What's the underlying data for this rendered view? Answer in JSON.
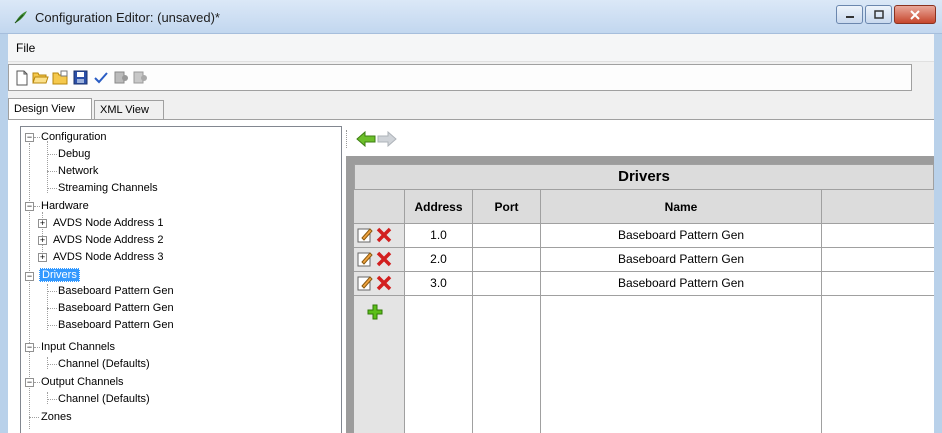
{
  "window": {
    "title": "Configuration Editor: (unsaved)*",
    "app_icon": "feather-logo-icon",
    "controls": [
      "minimize-icon",
      "maximize-icon",
      "close-icon"
    ]
  },
  "menu": {
    "file": "File"
  },
  "toolbar": {
    "buttons": [
      "new-icon",
      "open-icon",
      "open-folder-icon",
      "save-icon",
      "validate-check-icon",
      "deploy-icon",
      "deploy-disabled-icon"
    ]
  },
  "tabs": {
    "design": "Design View",
    "xml": "XML View"
  },
  "tree": {
    "configuration": "Configuration",
    "debug": "Debug",
    "network": "Network",
    "streaming": "Streaming Channels",
    "hardware": "Hardware",
    "avds1": "AVDS Node Address 1",
    "avds2": "AVDS Node Address 2",
    "avds3": "AVDS Node Address 3",
    "drivers": "Drivers",
    "drv1": "Baseboard Pattern Gen",
    "drv2": "Baseboard Pattern Gen",
    "drv3": "Baseboard Pattern Gen",
    "input": "Input Channels",
    "input_ch": "Channel  (Defaults)",
    "output": "Output Channels",
    "output_ch": "Channel  (Defaults)",
    "zones": "Zones",
    "expand_collapsed": "+",
    "expand_open": "−"
  },
  "nav": {
    "back": "back-arrow-icon",
    "forward": "forward-arrow-icon"
  },
  "grid": {
    "title": "Drivers",
    "columns": [
      "Address",
      "Port",
      "Name"
    ],
    "rows": [
      {
        "address": "1.0",
        "port": "",
        "name": "Baseboard Pattern Gen"
      },
      {
        "address": "2.0",
        "port": "",
        "name": "Baseboard Pattern Gen"
      },
      {
        "address": "3.0",
        "port": "",
        "name": "Baseboard Pattern Gen"
      }
    ],
    "row_icons": [
      "edit-icon",
      "delete-icon"
    ],
    "add_icon": "add-plus-icon"
  }
}
